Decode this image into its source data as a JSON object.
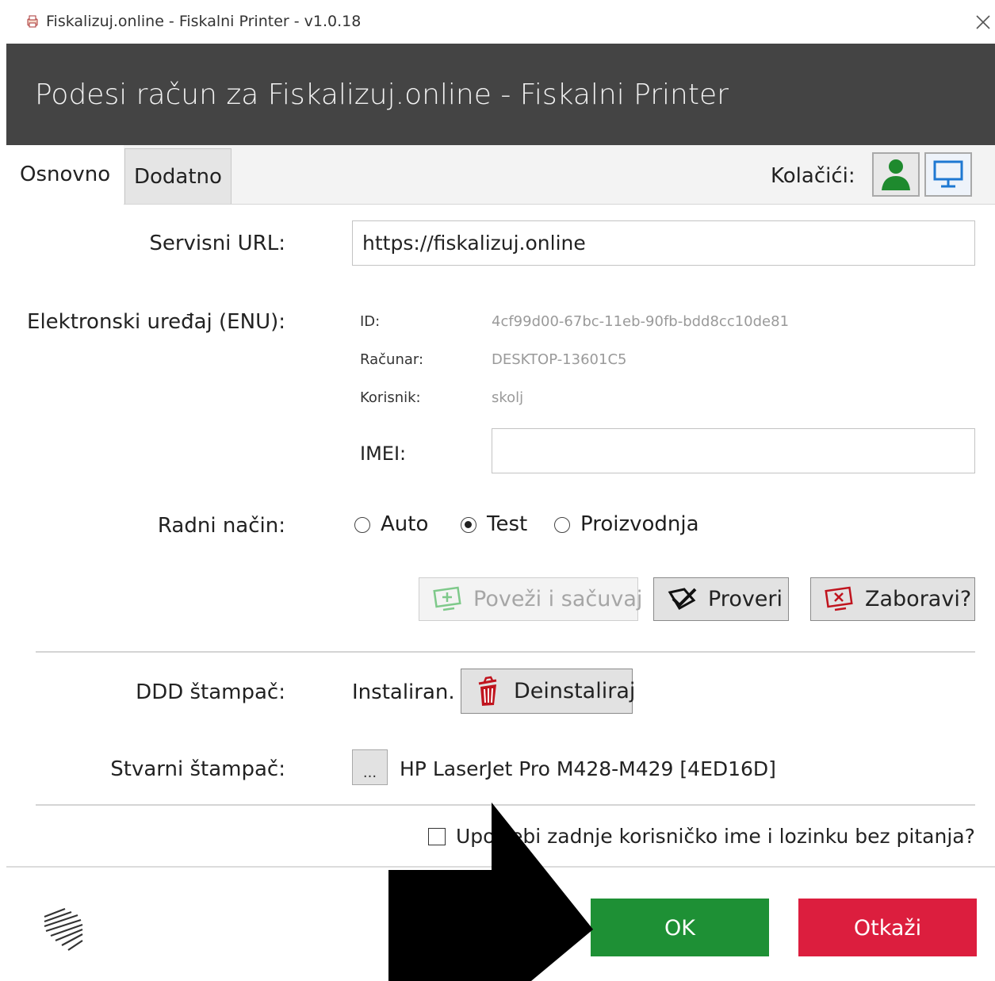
{
  "window": {
    "title": "Fiskalizuj.online - Fiskalni Printer - v1.0.18"
  },
  "header": {
    "title": "Podesi račun za Fiskalizuj.online - Fiskalni Printer"
  },
  "tabs": [
    {
      "label": "Osnovno",
      "active": true
    },
    {
      "label": "Dodatno",
      "active": false
    }
  ],
  "cookies": {
    "label": "Kolačići:",
    "user_icon": "user-icon",
    "computer_icon": "monitor-icon"
  },
  "service_url": {
    "label": "Servisni URL:",
    "value": "https://fiskalizuj.online"
  },
  "device": {
    "label": "Elektronski uređaj (ENU):",
    "id_label": "ID:",
    "id_value": "4cf99d00-67bc-11eb-90fb-bdd8cc10de81",
    "computer_label": "Računar:",
    "computer_value": "DESKTOP-13601C5",
    "user_label": "Korisnik:",
    "user_value": "skolj",
    "imei_label": "IMEI:",
    "imei_value": ""
  },
  "mode": {
    "label": "Radni način:",
    "options": [
      "Auto",
      "Test",
      "Proizvodnja"
    ],
    "selected": "Test"
  },
  "actions": {
    "connect_label": "Poveži i sačuvaj",
    "check_label": "Proveri",
    "forget_label": "Zaboravi?"
  },
  "ddd_printer": {
    "label": "DDD štampač:",
    "status": "Instaliran.",
    "uninstall_label": "Deinstaliraj"
  },
  "real_printer": {
    "label": "Stvarni štampač:",
    "browse_label": "...",
    "value": "HP LaserJet Pro M428-M429 [4ED16D]"
  },
  "remember": {
    "label": "Upotrebi zadnje korisničko ime i lozinku bez pitanja?",
    "checked": false
  },
  "footer": {
    "ok_label": "OK",
    "cancel_label": "Otkaži"
  },
  "colors": {
    "header_bg": "#444444",
    "ok": "#1e9035",
    "cancel": "#dc1e3e",
    "user_icon": "#1e8a2e",
    "monitor_icon": "#1e78d2",
    "trash_icon": "#c0141e"
  }
}
